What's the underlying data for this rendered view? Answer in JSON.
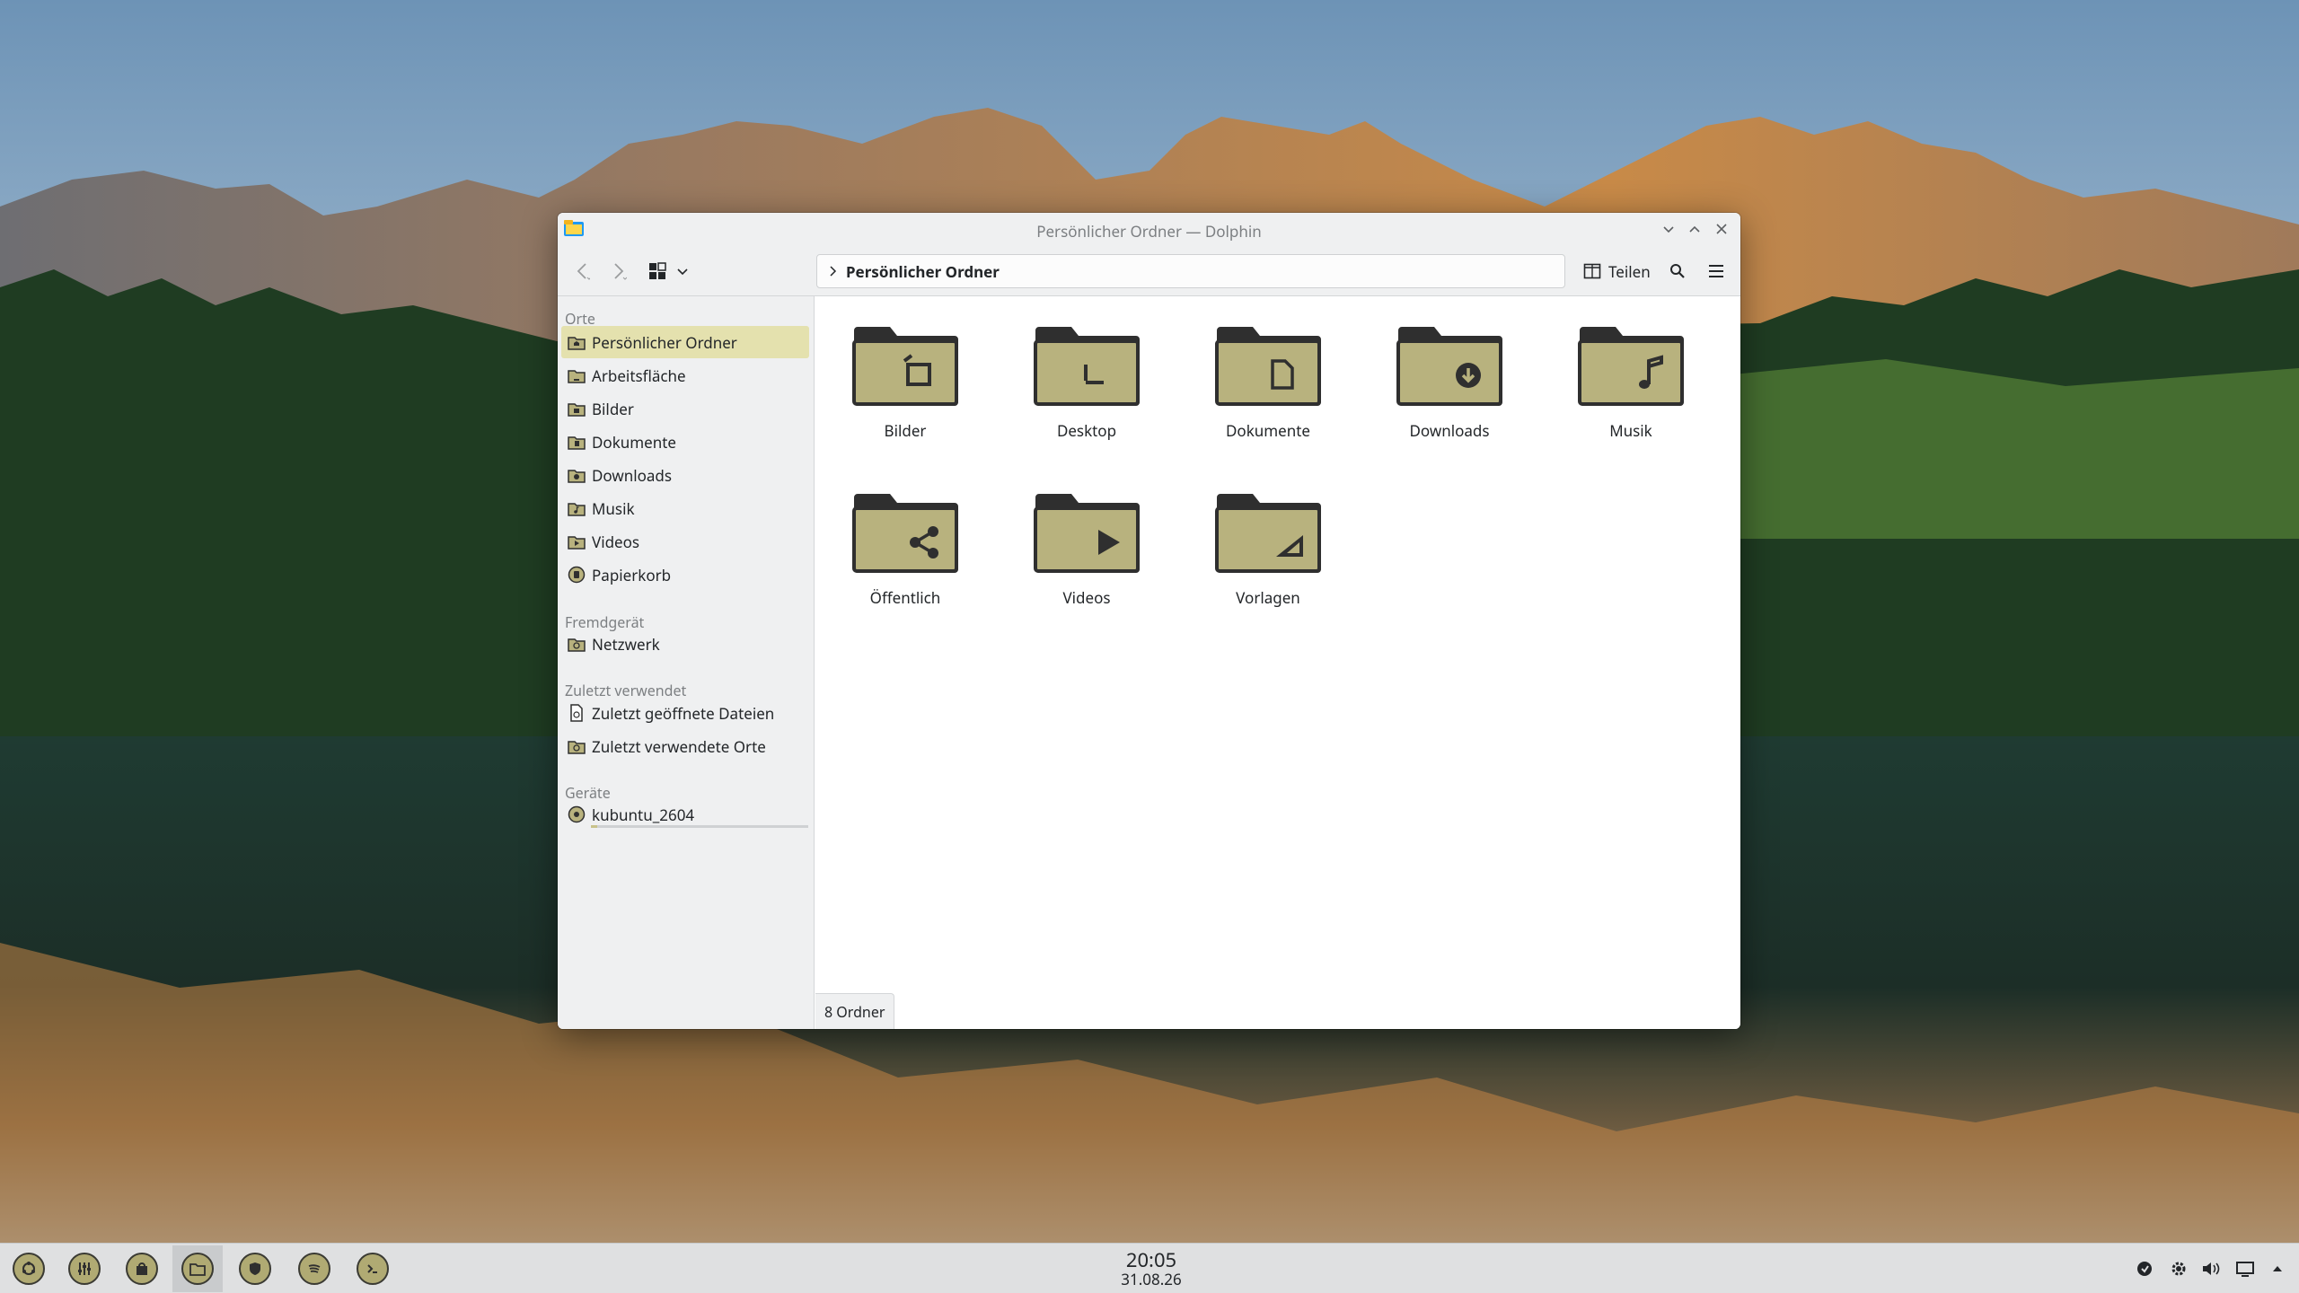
{
  "window": {
    "title": "Persönlicher Ordner — Dolphin",
    "breadcrumb": "Persönlicher Ordner",
    "share_label": "Teilen"
  },
  "sidebar": {
    "sections": [
      {
        "title": "Orte"
      },
      {
        "title": "Fremdgerät"
      },
      {
        "title": "Zuletzt verwendet"
      },
      {
        "title": "Geräte"
      }
    ],
    "places": [
      {
        "label": "Persönlicher Ordner",
        "icon": "home-folder-icon",
        "active": true
      },
      {
        "label": "Arbeitsfläche",
        "icon": "desktop-folder-icon"
      },
      {
        "label": "Bilder",
        "icon": "pictures-folder-icon"
      },
      {
        "label": "Dokumente",
        "icon": "documents-folder-icon"
      },
      {
        "label": "Downloads",
        "icon": "downloads-folder-icon"
      },
      {
        "label": "Musik",
        "icon": "music-folder-icon"
      },
      {
        "label": "Videos",
        "icon": "videos-folder-icon"
      },
      {
        "label": "Papierkorb",
        "icon": "trash-icon"
      }
    ],
    "remote": [
      {
        "label": "Netzwerk",
        "icon": "network-folder-icon"
      }
    ],
    "recent": [
      {
        "label": "Zuletzt geöffnete Dateien",
        "icon": "recent-files-icon"
      },
      {
        "label": "Zuletzt verwendete Orte",
        "icon": "recent-places-icon"
      }
    ],
    "devices": [
      {
        "label": "kubuntu_2604",
        "icon": "drive-icon",
        "usage_fraction": 0.03
      }
    ]
  },
  "content": {
    "folders": [
      {
        "name": "Bilder",
        "icon": "pictures-icon"
      },
      {
        "name": "Desktop",
        "icon": "desktop-icon"
      },
      {
        "name": "Dokumente",
        "icon": "document-icon"
      },
      {
        "name": "Downloads",
        "icon": "download-icon"
      },
      {
        "name": "Musik",
        "icon": "music-note-icon"
      },
      {
        "name": "Öffentlich",
        "icon": "share-icon"
      },
      {
        "name": "Videos",
        "icon": "play-icon"
      },
      {
        "name": "Vorlagen",
        "icon": "template-icon"
      }
    ],
    "status": "8 Ordner"
  },
  "panel": {
    "time": "20:05",
    "date": "31.08.26",
    "launchers": [
      "app-launcher-icon",
      "mixer-icon",
      "store-icon",
      "file-manager-icon",
      "security-icon",
      "spotify-icon",
      "terminal-icon"
    ],
    "tray": [
      "updates-icon",
      "settings-icon",
      "volume-icon",
      "display-icon",
      "expand-tray-icon"
    ]
  },
  "colors": {
    "accent": "#e4e1ae",
    "folder_body": "#b8b27e",
    "folder_dark": "#2f2f2f"
  }
}
